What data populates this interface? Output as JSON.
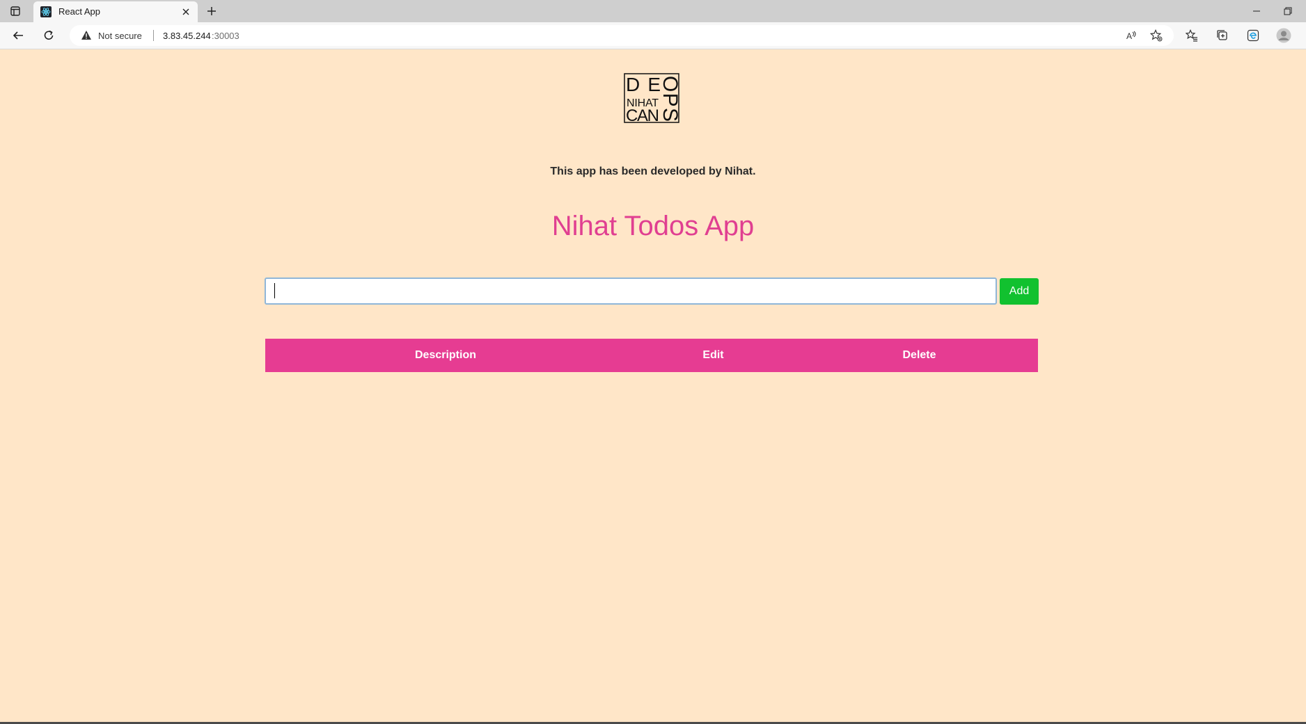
{
  "browser": {
    "tab_title": "React App",
    "security_label": "Not secure",
    "url_host": "3.83.45.244",
    "url_port": ":30003"
  },
  "page": {
    "logo_text": "DEVOPS NIHAT CAN",
    "developer_note": "This app has been developed by Nihat.",
    "title": "Nihat Todos App",
    "input_value": "",
    "input_placeholder": "",
    "add_label": "Add",
    "columns": [
      "Description",
      "Edit",
      "Delete"
    ]
  },
  "colors": {
    "background": "#ffe6c8",
    "title": "#e03f91",
    "header": "#e63c92",
    "add_button": "#11c12f"
  }
}
